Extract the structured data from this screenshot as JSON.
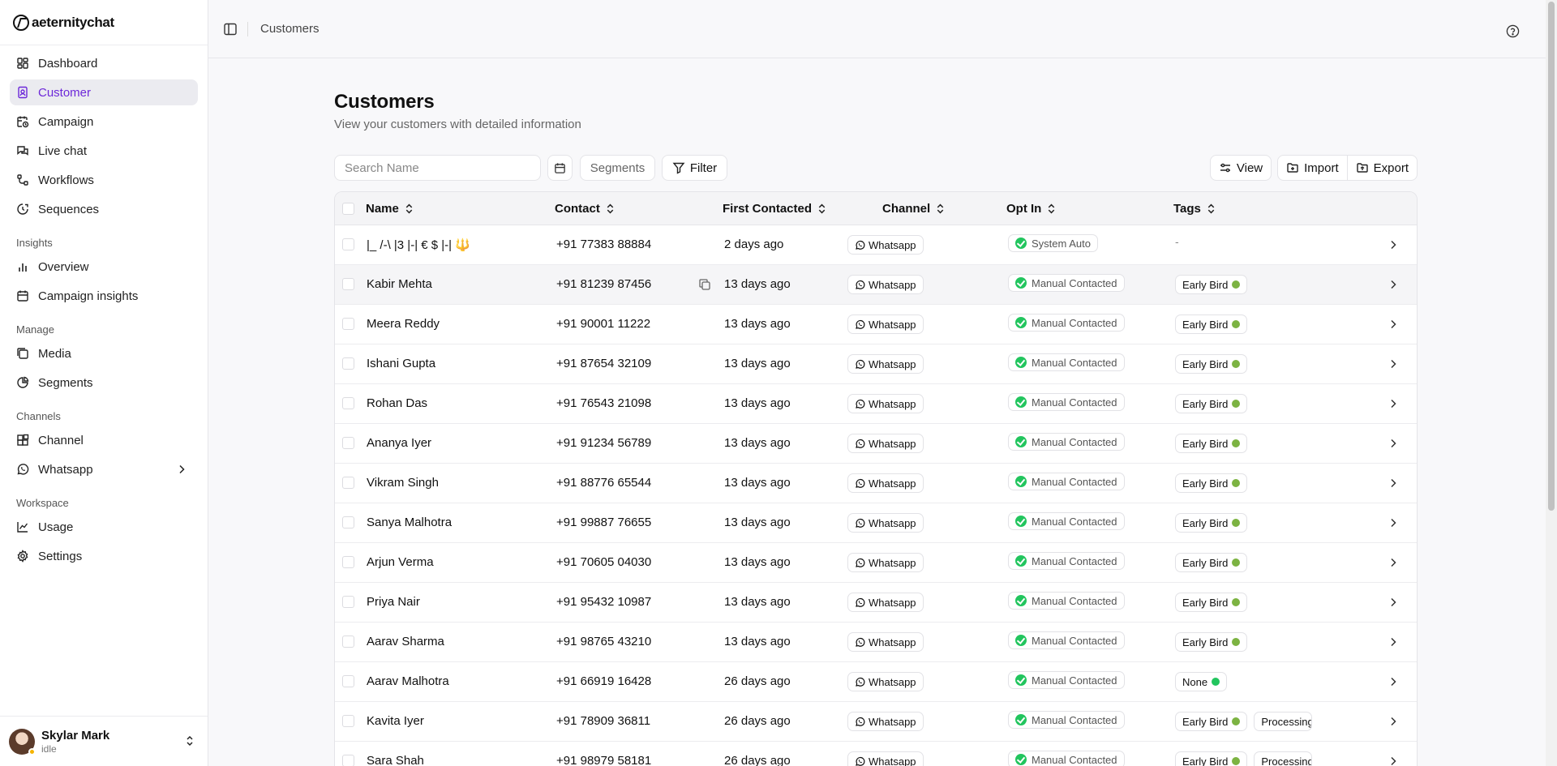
{
  "brand": {
    "name": "aeternitychat"
  },
  "sidebar": {
    "main_items": [
      {
        "label": "Dashboard",
        "icon": "dashboard-icon"
      },
      {
        "label": "Customer",
        "icon": "contact-icon",
        "active": true
      },
      {
        "label": "Campaign",
        "icon": "calendar-clock-icon"
      },
      {
        "label": "Live chat",
        "icon": "chat-icon"
      },
      {
        "label": "Workflows",
        "icon": "workflow-icon"
      },
      {
        "label": "Sequences",
        "icon": "sequence-icon"
      }
    ],
    "insights_label": "Insights",
    "insights_items": [
      {
        "label": "Overview",
        "icon": "bar-chart-icon"
      },
      {
        "label": "Campaign insights",
        "icon": "calendar-icon"
      }
    ],
    "manage_label": "Manage",
    "manage_items": [
      {
        "label": "Media",
        "icon": "media-icon"
      },
      {
        "label": "Segments",
        "icon": "pie-chart-icon"
      }
    ],
    "channels_label": "Channels",
    "channels_items": [
      {
        "label": "Channel",
        "icon": "blocks-icon"
      },
      {
        "label": "Whatsapp",
        "icon": "whatsapp-icon"
      }
    ],
    "workspace_label": "Workspace",
    "workspace_items": [
      {
        "label": "Usage",
        "icon": "line-chart-icon"
      },
      {
        "label": "Settings",
        "icon": "gear-icon"
      }
    ]
  },
  "user": {
    "name": "Skylar Mark",
    "status": "idle"
  },
  "topbar": {
    "breadcrumb": "Customers"
  },
  "page": {
    "title": "Customers",
    "subtitle": "View your customers with detailed information"
  },
  "toolbar": {
    "search_placeholder": "Search Name",
    "segments_label": "Segments",
    "filter_label": "Filter",
    "view_label": "View",
    "import_label": "Import",
    "export_label": "Export"
  },
  "table": {
    "headers": [
      "Name",
      "Contact",
      "First Contacted",
      "Channel",
      "Opt In",
      "Tags"
    ],
    "rows": [
      {
        "name": "|_ /-\\ |3 |-| € $ |-|",
        "emoji": "🔱",
        "contact": "+91 77383 88884",
        "first": "2 days ago",
        "channel": "Whatsapp",
        "optin": "System Auto",
        "tags": [],
        "no_tag": "-"
      },
      {
        "name": "Kabir Mehta",
        "contact": "+91 81239 87456",
        "first": "13 days ago",
        "channel": "Whatsapp",
        "optin": "Manual Contacted",
        "tags": [
          "Early Bird"
        ]
      },
      {
        "name": "Meera Reddy",
        "contact": "+91 90001 11222",
        "first": "13 days ago",
        "channel": "Whatsapp",
        "optin": "Manual Contacted",
        "tags": [
          "Early Bird"
        ]
      },
      {
        "name": "Ishani Gupta",
        "contact": "+91 87654 32109",
        "first": "13 days ago",
        "channel": "Whatsapp",
        "optin": "Manual Contacted",
        "tags": [
          "Early Bird"
        ]
      },
      {
        "name": "Rohan Das",
        "contact": "+91 76543 21098",
        "first": "13 days ago",
        "channel": "Whatsapp",
        "optin": "Manual Contacted",
        "tags": [
          "Early Bird"
        ]
      },
      {
        "name": "Ananya Iyer",
        "contact": "+91 91234 56789",
        "first": "13 days ago",
        "channel": "Whatsapp",
        "optin": "Manual Contacted",
        "tags": [
          "Early Bird"
        ]
      },
      {
        "name": "Vikram Singh",
        "contact": "+91 88776 65544",
        "first": "13 days ago",
        "channel": "Whatsapp",
        "optin": "Manual Contacted",
        "tags": [
          "Early Bird"
        ]
      },
      {
        "name": "Sanya Malhotra",
        "contact": "+91 99887 76655",
        "first": "13 days ago",
        "channel": "Whatsapp",
        "optin": "Manual Contacted",
        "tags": [
          "Early Bird"
        ]
      },
      {
        "name": "Arjun Verma",
        "contact": "+91 70605 04030",
        "first": "13 days ago",
        "channel": "Whatsapp",
        "optin": "Manual Contacted",
        "tags": [
          "Early Bird"
        ]
      },
      {
        "name": "Priya Nair",
        "contact": "+91 95432 10987",
        "first": "13 days ago",
        "channel": "Whatsapp",
        "optin": "Manual Contacted",
        "tags": [
          "Early Bird"
        ]
      },
      {
        "name": "Aarav Sharma",
        "contact": "+91 98765 43210",
        "first": "13 days ago",
        "channel": "Whatsapp",
        "optin": "Manual Contacted",
        "tags": [
          "Early Bird"
        ]
      },
      {
        "name": "Aarav Malhotra",
        "contact": "+91 66919 16428",
        "first": "26 days ago",
        "channel": "Whatsapp",
        "optin": "Manual Contacted",
        "tags": [
          "None"
        ]
      },
      {
        "name": "Kavita Iyer",
        "contact": "+91 78909 36811",
        "first": "26 days ago",
        "channel": "Whatsapp",
        "optin": "Manual Contacted",
        "tags": [
          "Early Bird",
          "Processing"
        ]
      },
      {
        "name": "Sara Shah",
        "contact": "+91 98979 58181",
        "first": "26 days ago",
        "channel": "Whatsapp",
        "optin": "Manual Contacted",
        "tags": [
          "Early Bird",
          "Processing"
        ]
      }
    ]
  },
  "colors": {
    "accent": "#6d28d9",
    "optin_check": "#22c55e",
    "tag_early_bird": "#7cb342",
    "tag_none": "#22c55e",
    "name_emoji": "#f59e0b"
  }
}
